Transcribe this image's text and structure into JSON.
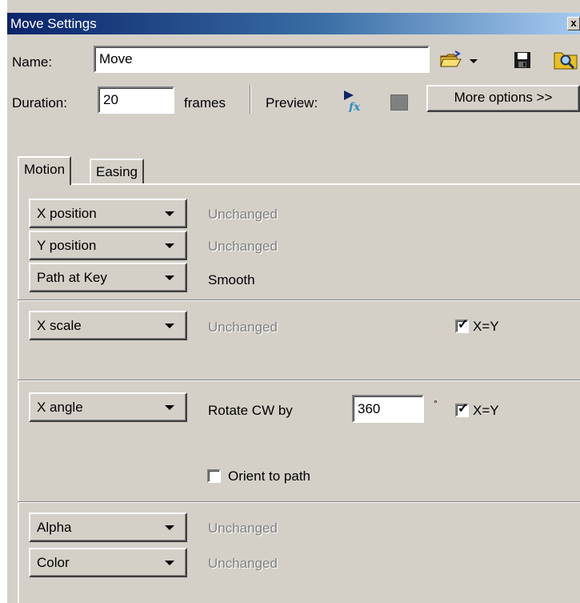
{
  "window": {
    "title": "Move Settings",
    "close_glyph": "x"
  },
  "name": {
    "label": "Name:",
    "value": "Move"
  },
  "duration": {
    "label": "Duration:",
    "value": "20",
    "unit": "frames"
  },
  "preview": {
    "label": "Preview:"
  },
  "toolbar": {
    "open_icon": "folder-open-icon",
    "save_icon": "save-icon",
    "browse_icon": "folder-search-icon"
  },
  "more_options": {
    "label": "More options >>"
  },
  "tabs": [
    {
      "label": "Motion",
      "active": true
    },
    {
      "label": "Easing",
      "active": false
    }
  ],
  "motion": {
    "x_position": {
      "dropdown": "X position",
      "value": "Unchanged"
    },
    "y_position": {
      "dropdown": "Y position",
      "value": "Unchanged"
    },
    "path_at_key": {
      "dropdown": "Path at Key",
      "value": "Smooth"
    },
    "x_scale": {
      "dropdown": "X scale",
      "value": "Unchanged",
      "lock_label": "X=Y",
      "lock_checked": true
    },
    "x_angle": {
      "dropdown": "X angle",
      "value_label": "Rotate CW by",
      "degrees": "360",
      "degree_symbol": "°",
      "lock_label": "X=Y",
      "lock_checked": true
    },
    "orient_to_path": {
      "label": "Orient to path",
      "checked": false
    },
    "alpha": {
      "dropdown": "Alpha",
      "value": "Unchanged"
    },
    "color": {
      "dropdown": "Color",
      "value": "Unchanged"
    }
  },
  "colors": {
    "title_start": "#0a246a",
    "title_end": "#a6caf0",
    "face": "#d4d0c8"
  }
}
